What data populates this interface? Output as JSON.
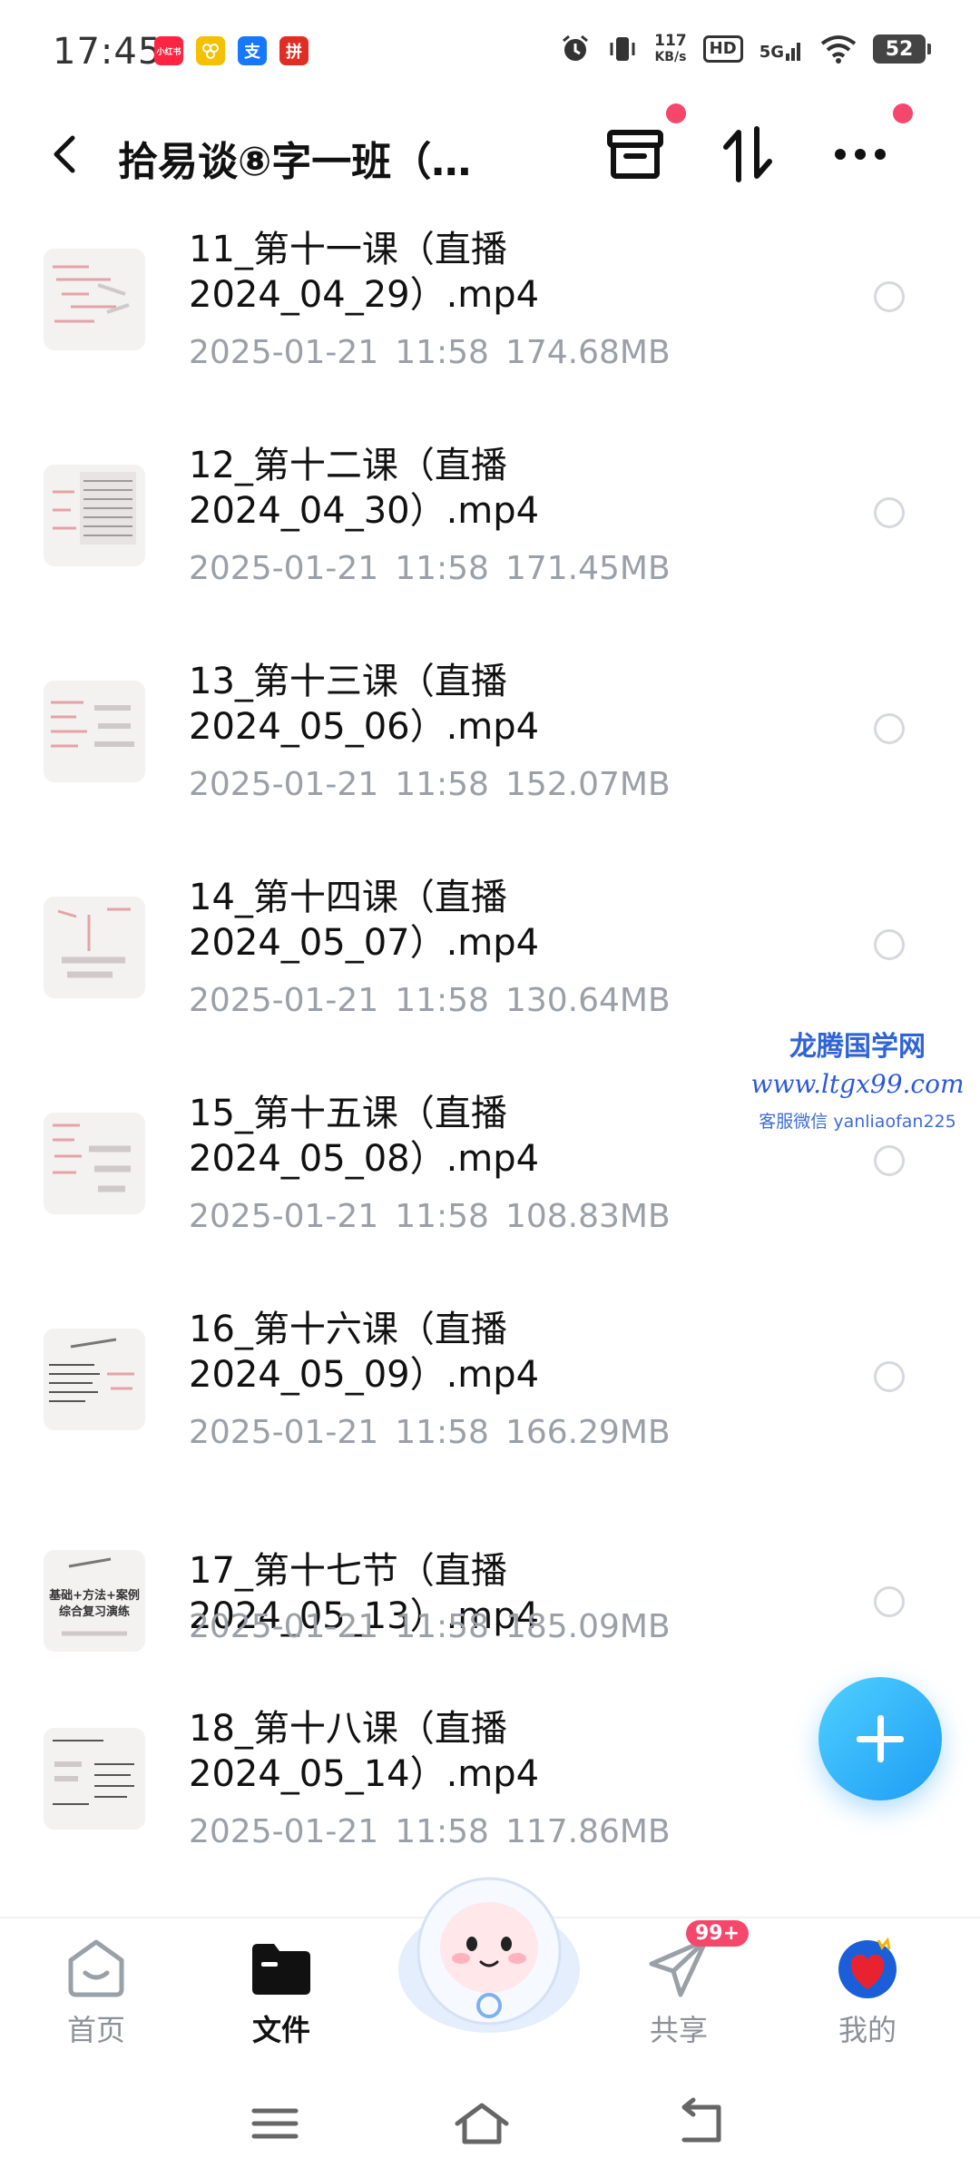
{
  "status_bar": {
    "time": "17:45",
    "app_icons": [
      {
        "name": "xiaohongshu-icon",
        "label": "小红书",
        "color": "#ff2442"
      },
      {
        "name": "meituan-icon",
        "label": "",
        "color": "#f5c000"
      },
      {
        "name": "alipay-icon",
        "label": "支",
        "color": "#1677ff"
      },
      {
        "name": "pinduoduo-icon",
        "label": "拼",
        "color": "#e02e24"
      }
    ],
    "net_speed_value": "117",
    "net_speed_unit": "KB/s",
    "hd_label": "HD",
    "signal_label": "5G",
    "battery": "52"
  },
  "header": {
    "title": "拾易谈⑧字一班（…"
  },
  "files": [
    {
      "name": "11_第十一课（直播\n2024_04_29）.mp4",
      "date": "2025-01-21",
      "time": "11:58",
      "size": "174.68MB"
    },
    {
      "name": "12_第十二课（直播\n2024_04_30）.mp4",
      "date": "2025-01-21",
      "time": "11:58",
      "size": "171.45MB"
    },
    {
      "name": "13_第十三课（直播\n2024_05_06）.mp4",
      "date": "2025-01-21",
      "time": "11:58",
      "size": "152.07MB"
    },
    {
      "name": "14_第十四课（直播\n2024_05_07）.mp4",
      "date": "2025-01-21",
      "time": "11:58",
      "size": "130.64MB"
    },
    {
      "name": "15_第十五课（直播\n2024_05_08）.mp4",
      "date": "2025-01-21",
      "time": "11:58",
      "size": "108.83MB"
    },
    {
      "name": "16_第十六课（直播\n2024_05_09）.mp4",
      "date": "2025-01-21",
      "time": "11:58",
      "size": "166.29MB"
    },
    {
      "name": "17_第十七节（直播2024_05_13）.mp4",
      "date": "2025-01-21",
      "time": "11:58",
      "size": "185.09MB",
      "thumb_text_1": "基础+方法+案例",
      "thumb_text_2": "综合复习演练"
    },
    {
      "name": "18_第十八课（直播\n2024_05_14）.mp4",
      "date": "2025-01-21",
      "time": "11:58",
      "size": "117.86MB"
    }
  ],
  "watermark": {
    "line1": "龙腾国学网",
    "line2": "www.ltgx99.com",
    "line3": "客服微信 yanliaofan225"
  },
  "bottom_nav": {
    "items": [
      {
        "label": "首页",
        "icon": "home-icon"
      },
      {
        "label": "文件",
        "icon": "folder-icon",
        "active": true
      },
      {
        "label": "共享",
        "icon": "paper-plane-icon",
        "badge": "99+"
      },
      {
        "label": "我的",
        "icon": "heart-avatar-icon"
      }
    ]
  },
  "colors": {
    "accent": "#1e9cf5",
    "badge": "#f4476b",
    "meta_text": "#9aa0a8"
  }
}
